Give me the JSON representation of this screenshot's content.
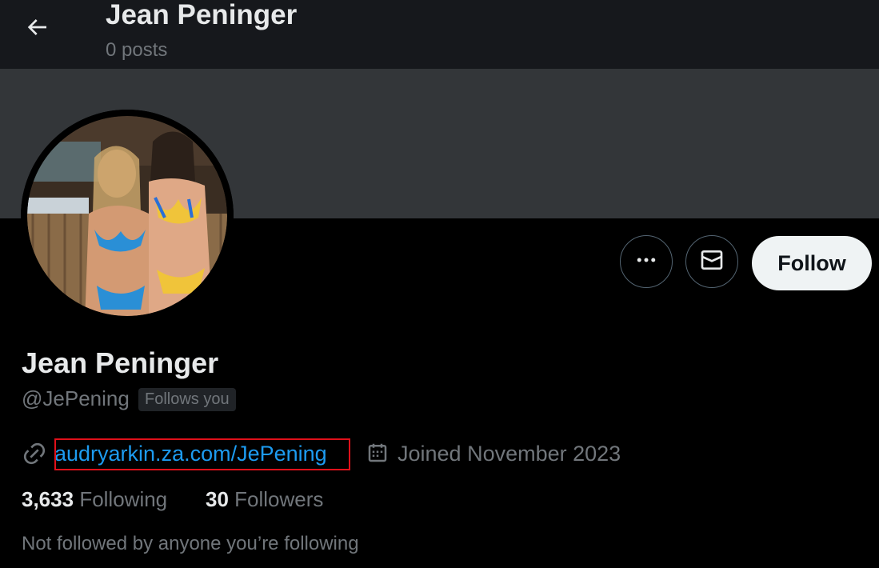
{
  "header": {
    "title": "Jean Peninger",
    "post_count": "0 posts"
  },
  "profile": {
    "display_name": "Jean Peninger",
    "handle": "@JePening",
    "follows_you_badge": "Follows you",
    "link_text": "audryarkin.za.com/JePening",
    "joined": "Joined November 2023",
    "following_count": "3,633",
    "following_label": "Following",
    "followers_count": "30",
    "followers_label": "Followers",
    "social_context": "Not followed by anyone you’re following"
  },
  "actions": {
    "more_icon": "more-horizontal-icon",
    "message_icon": "envelope-icon",
    "follow_label": "Follow"
  },
  "colors": {
    "background": "#000000",
    "header_bg": "#16181c",
    "banner": "#333639",
    "link": "#1d9bf0",
    "secondary_text": "#71767b",
    "highlight_box": "#e0101a"
  }
}
